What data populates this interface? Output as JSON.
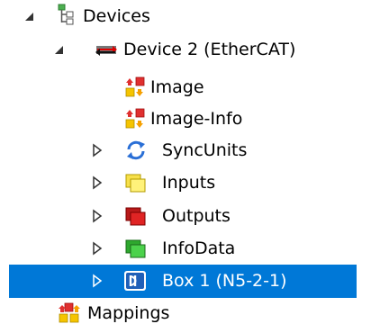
{
  "colors": {
    "selection": "#0078d7",
    "selected_text": "#ffffff",
    "text": "#000000"
  },
  "tree": {
    "devices": {
      "label": "Devices",
      "icon": "devices-tree-icon",
      "state": "expanded"
    },
    "device2": {
      "label": "Device 2 (EtherCAT)",
      "icon": "ethercat-device-icon",
      "state": "expanded"
    },
    "image": {
      "label": "Image",
      "icon": "process-image-icon"
    },
    "image_info": {
      "label": "Image-Info",
      "icon": "process-image-icon"
    },
    "syncunits": {
      "label": "SyncUnits",
      "icon": "sync-arrows-icon",
      "state": "collapsed"
    },
    "inputs": {
      "label": "Inputs",
      "icon": "inputs-yellow-icon",
      "state": "collapsed"
    },
    "outputs": {
      "label": "Outputs",
      "icon": "outputs-red-icon",
      "state": "collapsed"
    },
    "infodata": {
      "label": "InfoData",
      "icon": "infodata-green-icon",
      "state": "collapsed"
    },
    "box1": {
      "label": "Box 1 (N5-2-1)",
      "icon": "box-module-icon",
      "state": "collapsed",
      "selected": true
    },
    "mappings": {
      "label": "Mappings",
      "icon": "mappings-icon"
    }
  }
}
